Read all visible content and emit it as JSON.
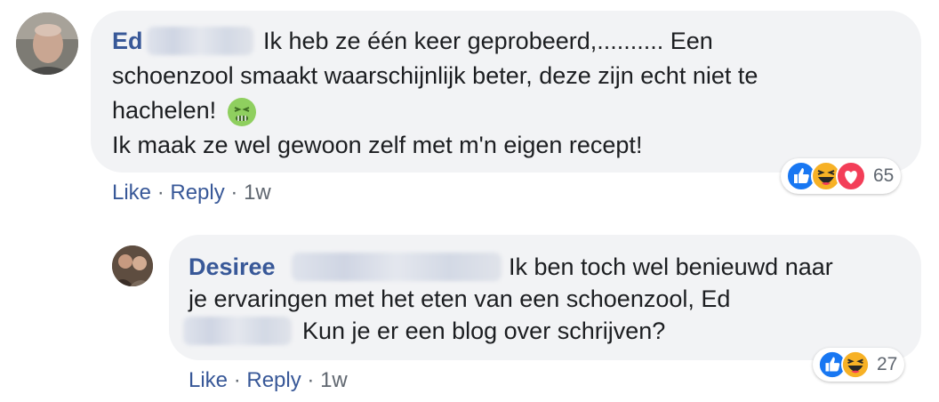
{
  "comments": [
    {
      "author": "Ed",
      "lines": [
        "Ik heb ze één keer geprobeerd,.......... Een",
        "schoenzool smaakt waarschijnlijk beter, deze zijn echt niet te",
        "hachelen!",
        "Ik maak ze wel gewoon zelf met m'n eigen recept!"
      ],
      "emoji": "nauseated-face",
      "actions": {
        "like": "Like",
        "reply": "Reply",
        "separator": "·",
        "time": "1w"
      },
      "reactions": {
        "types": [
          "like",
          "haha",
          "love"
        ],
        "count": "65"
      }
    },
    {
      "author": "Desiree",
      "lines": [
        "Ik ben toch wel benieuwd naar",
        "je ervaringen met het eten van een schoenzool, Ed",
        "Kun je er een blog over schrijven?"
      ],
      "actions": {
        "like": "Like",
        "reply": "Reply",
        "separator": "·",
        "time": "1w"
      },
      "reactions": {
        "types": [
          "like",
          "haha"
        ],
        "count": "27"
      }
    }
  ],
  "colors": {
    "author": "#385898",
    "bubble": "#f2f3f5",
    "like": "#1877f2",
    "love": "#f33e58",
    "haha": "#f7b125"
  }
}
